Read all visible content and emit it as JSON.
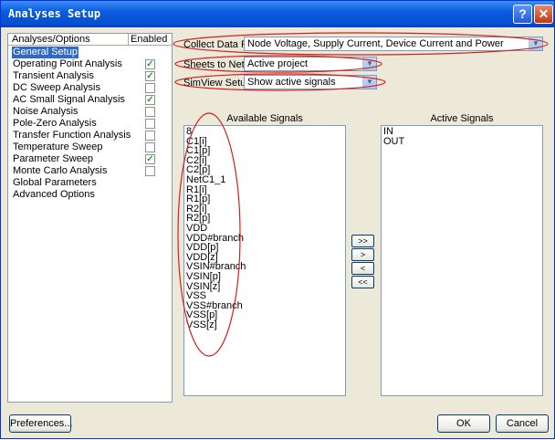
{
  "window": {
    "title": "Analyses Setup"
  },
  "titlebar": {
    "help_label": "?",
    "close_label": "✕"
  },
  "tree": {
    "col_analyses": "Analyses/Options",
    "col_enabled": "Enabled",
    "items": [
      {
        "label": "General Setup",
        "enabled": null,
        "selected": true
      },
      {
        "label": "Operating Point Analysis",
        "enabled": true
      },
      {
        "label": "Transient Analysis",
        "enabled": true
      },
      {
        "label": "DC Sweep Analysis",
        "enabled": false
      },
      {
        "label": "AC Small Signal Analysis",
        "enabled": true
      },
      {
        "label": "Noise Analysis",
        "enabled": false
      },
      {
        "label": "Pole-Zero Analysis",
        "enabled": false
      },
      {
        "label": "Transfer Function Analysis",
        "enabled": false
      },
      {
        "label": "Temperature Sweep",
        "enabled": false
      },
      {
        "label": "Parameter Sweep",
        "enabled": true
      },
      {
        "label": "Monte Carlo Analysis",
        "enabled": false
      },
      {
        "label": "Global Parameters",
        "enabled": null
      },
      {
        "label": "Advanced Options",
        "enabled": null
      }
    ]
  },
  "settings": {
    "collect_label": "Collect Data For",
    "collect_value": "Node Voltage, Supply Current, Device Current and Power",
    "sheets_label": "Sheets to Netlist",
    "sheets_value": "Active project",
    "simview_label": "SimView Setup",
    "simview_value": "Show active signals"
  },
  "signals": {
    "available_header": "Available Signals",
    "active_header": "Active Signals",
    "available": [
      "8",
      "C1[i]",
      "C1[p]",
      "C2[i]",
      "C2[p]",
      "NetC1_1",
      "R1[i]",
      "R1[p]",
      "R2[i]",
      "R2[p]",
      "VDD",
      "VDD#branch",
      "VDD[p]",
      "VDD[z]",
      "VSIN#branch",
      "VSIN[p]",
      "VSIN[z]",
      "VSS",
      "VSS#branch",
      "VSS[p]",
      "VSS[z]"
    ],
    "active": [
      "IN",
      "OUT"
    ]
  },
  "move_buttons": {
    "add_all": ">>",
    "add": ">",
    "remove": "<",
    "remove_all": "<<"
  },
  "footer": {
    "preferences": "Preferences...",
    "ok": "OK",
    "cancel": "Cancel"
  },
  "icons": {
    "dropdown": "chevron-down-icon",
    "check": "checkmark-icon"
  },
  "colors": {
    "annotation": "#d42020",
    "selection": "#316ac5",
    "titlebar": "#0a5ce0"
  }
}
